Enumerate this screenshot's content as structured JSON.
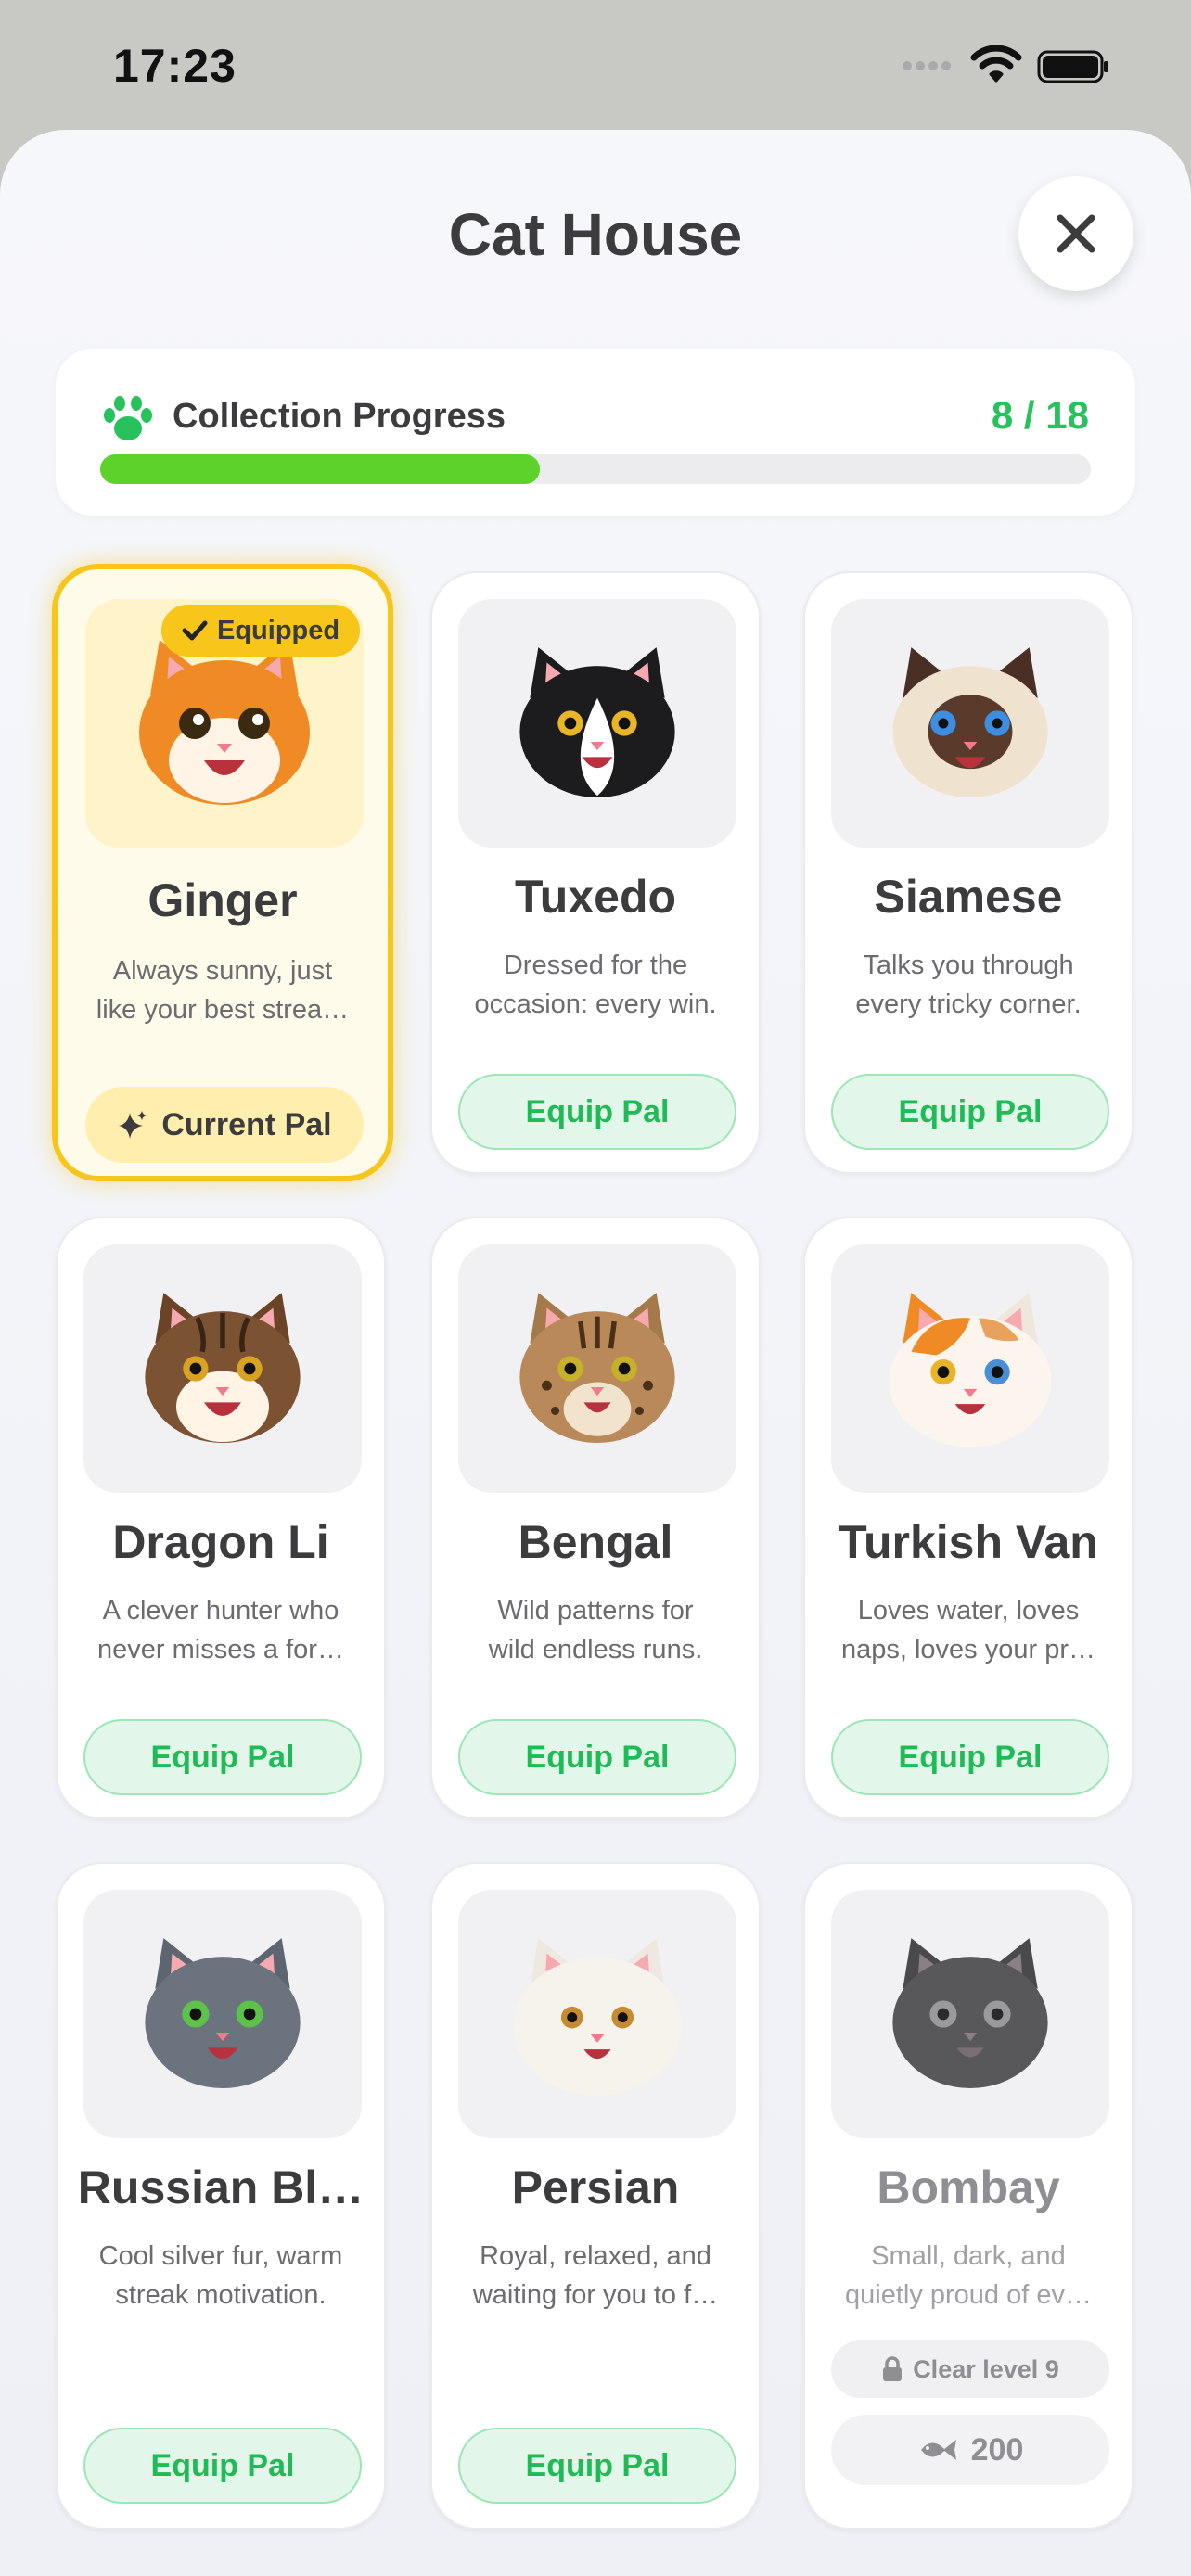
{
  "status_bar": {
    "time": "17:23"
  },
  "header": {
    "title": "Cat House"
  },
  "progress": {
    "label": "Collection Progress",
    "count": "8 / 18",
    "fraction": 0.444
  },
  "colors": {
    "accent_green": "#27c25c",
    "progress_fill": "#5dd22a",
    "equipped_gold": "#f6c61a"
  },
  "cats": [
    {
      "name": "Ginger",
      "desc": [
        "Always sunny, just",
        "like your best strea…"
      ],
      "state": "equipped",
      "badge": "Equipped",
      "button": "Current Pal"
    },
    {
      "name": "Tuxedo",
      "desc": [
        "Dressed for the",
        "occasion: every win."
      ],
      "state": "available",
      "button": "Equip Pal"
    },
    {
      "name": "Siamese",
      "desc": [
        "Talks you through",
        "every tricky corner."
      ],
      "state": "available",
      "button": "Equip Pal"
    },
    {
      "name": "Dragon Li",
      "desc": [
        "A clever hunter who",
        "never misses a for…"
      ],
      "state": "available",
      "button": "Equip Pal"
    },
    {
      "name": "Bengal",
      "desc": [
        "Wild patterns for",
        "wild endless runs."
      ],
      "state": "available",
      "button": "Equip Pal"
    },
    {
      "name": "Turkish Van",
      "desc": [
        "Loves water, loves",
        "naps, loves your pr…"
      ],
      "state": "available",
      "button": "Equip Pal"
    },
    {
      "name": "Russian Bl…",
      "desc": [
        "Cool silver fur, warm",
        "streak motivation."
      ],
      "state": "available",
      "button": "Equip Pal"
    },
    {
      "name": "Persian",
      "desc": [
        "Royal, relaxed, and",
        "waiting for you to f…"
      ],
      "state": "available",
      "button": "Equip Pal"
    },
    {
      "name": "Bombay",
      "desc": [
        "Small, dark, and",
        "quietly proud of ev…"
      ],
      "state": "locked",
      "lock_text": "Clear level 9",
      "cost": "200"
    }
  ]
}
